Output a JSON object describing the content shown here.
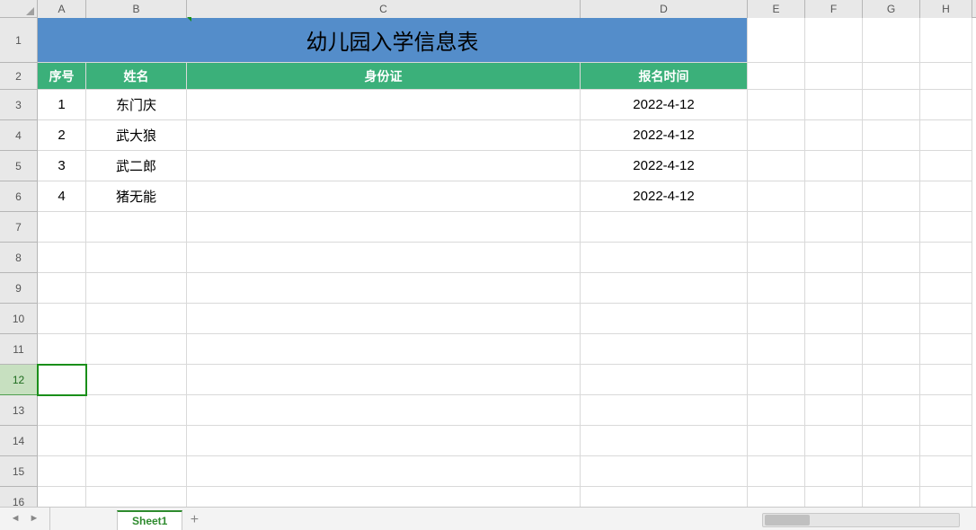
{
  "columns": [
    "A",
    "B",
    "C",
    "D",
    "E",
    "F",
    "G",
    "H"
  ],
  "rowsVisible": 16,
  "activeRow": 12,
  "title": "幼儿园入学信息表",
  "headers": {
    "seq": "序号",
    "name": "姓名",
    "id": "身份证",
    "date": "报名时间"
  },
  "rows": [
    {
      "seq": "1",
      "name": "东门庆",
      "id": "",
      "date": "2022-4-12"
    },
    {
      "seq": "2",
      "name": "武大狼",
      "id": "",
      "date": "2022-4-12"
    },
    {
      "seq": "3",
      "name": "武二郎",
      "id": "",
      "date": "2022-4-12"
    },
    {
      "seq": "4",
      "name": "猪无能",
      "id": "",
      "date": "2022-4-12"
    }
  ],
  "tabs": {
    "active": "Sheet1"
  }
}
